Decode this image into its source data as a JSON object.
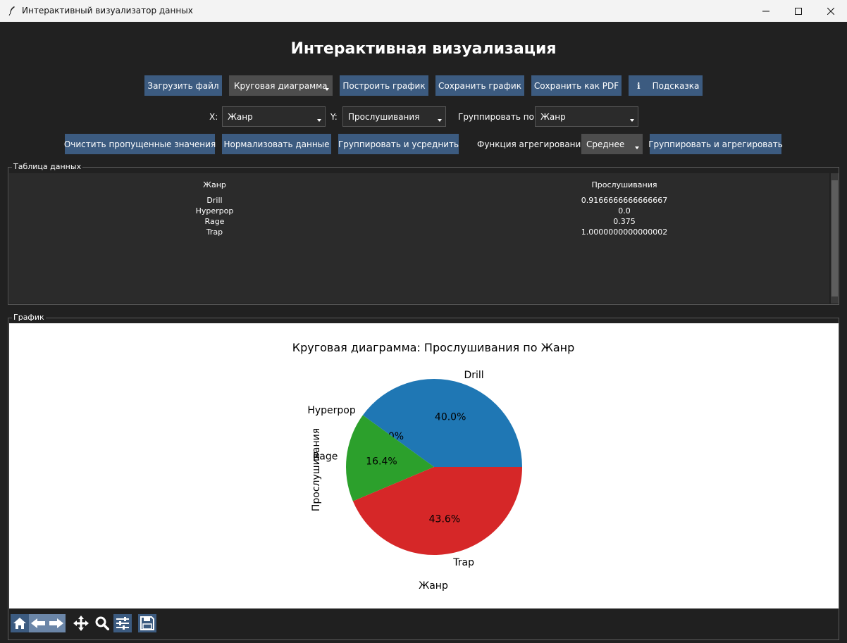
{
  "window": {
    "title": "Интерактивный визуализатор данных"
  },
  "heading": "Интерактивная визуализация",
  "row1": {
    "load_file": "Загрузить файл",
    "chart_type": "Круговая диаграмма",
    "build_chart": "Построить график",
    "save_chart": "Сохранить график",
    "save_pdf": "Сохранить как PDF",
    "hint_icon": "ℹ",
    "hint": "Подсказка"
  },
  "row2": {
    "x_label": "X:",
    "x_value": "Жанр",
    "y_label": "Y:",
    "y_value": "Прослушивания",
    "group_label": "Группировать по:",
    "group_value": "Жанр"
  },
  "row3": {
    "clean_missing": "Очистить пропущенные значения",
    "normalize": "Нормализовать данные",
    "group_avg": "Группировать и усреднить",
    "agg_label": "Функция агрегирования:",
    "agg_value": "Среднее",
    "group_agg": "Группировать и агрегировать"
  },
  "table_frame": {
    "title": "Таблица данных",
    "columns": [
      "Жанр",
      "Прослушивания"
    ],
    "rows": [
      [
        "Drill",
        "0.9166666666666667"
      ],
      [
        "Hyperpop",
        "0.0"
      ],
      [
        "Rage",
        "0.375"
      ],
      [
        "Trap",
        "1.0000000000000002"
      ]
    ]
  },
  "chart_frame": {
    "title": "График"
  },
  "chart_data": {
    "type": "pie",
    "title": "Круговая диаграмма: Прослушивания по Жанр",
    "xlabel": "Жанр",
    "ylabel": "Прослушивания",
    "slices": [
      {
        "label": "Drill",
        "value": 0.9166666666666667,
        "pct": "40.0%",
        "color": "#1f77b4"
      },
      {
        "label": "Hyperpop",
        "value": 0.0,
        "pct": "0.0%",
        "color": "#ff7f0e"
      },
      {
        "label": "Rage",
        "value": 0.375,
        "pct": "16.4%",
        "color": "#2ca02c"
      },
      {
        "label": "Trap",
        "value": 1.0000000000000002,
        "pct": "43.6%",
        "color": "#d62728"
      }
    ]
  },
  "toolbar_icons": [
    "home-icon",
    "back-icon",
    "forward-icon",
    "pan-icon",
    "zoom-icon",
    "configure-subplots-icon",
    "save-icon"
  ],
  "colors": {
    "button": "#3c5b80",
    "combo": "#4d4d4d",
    "background": "#212121"
  }
}
